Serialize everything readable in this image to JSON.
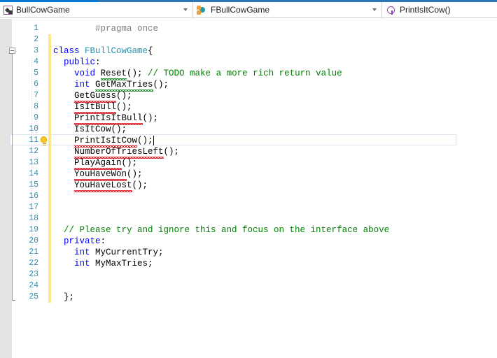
{
  "window": {
    "accent_color": "#0078D4",
    "accent_secondary": "#2E75B6"
  },
  "navbar": {
    "project": {
      "label": "BullCowGame",
      "icon": "project-icon",
      "dropdown_icon": "chevron-down-icon"
    },
    "type": {
      "label": "FBullCowGame",
      "icon": "class-icon",
      "dropdown_icon": "chevron-down-icon"
    },
    "member": {
      "label": "PrintIsItCow()",
      "icon": "method-icon"
    }
  },
  "editor": {
    "change_bar_color": "#FFE88C",
    "line_number_color": "#2B91AF",
    "current_line": 11,
    "quick_action_line": 11,
    "quick_action_icon": "lightbulb-icon",
    "lines": [
      {
        "n": "1",
        "indent": 4,
        "tokens": [
          {
            "t": "#pragma once",
            "c": "pre"
          }
        ]
      },
      {
        "n": "2",
        "indent": 0,
        "tokens": []
      },
      {
        "n": "3",
        "indent": 0,
        "fold": "start",
        "tokens": [
          {
            "t": "class ",
            "c": "kw"
          },
          {
            "t": "FBullCowGame",
            "c": "typ"
          },
          {
            "t": "{",
            "c": "pun"
          }
        ]
      },
      {
        "n": "4",
        "indent": 1,
        "tokens": [
          {
            "t": "public",
            "c": "kw"
          },
          {
            "t": ":",
            "c": "pun"
          }
        ]
      },
      {
        "n": "5",
        "indent": 2,
        "tokens": [
          {
            "t": "void ",
            "c": "kw"
          },
          {
            "t": "Reset",
            "c": "idn",
            "sq": "green"
          },
          {
            "t": "(); ",
            "c": "pun"
          },
          {
            "t": "// TODO make a more rich return value",
            "c": "cmt"
          }
        ]
      },
      {
        "n": "6",
        "indent": 2,
        "tokens": [
          {
            "t": "int ",
            "c": "kw"
          },
          {
            "t": "GetMaxTries",
            "c": "idn",
            "sq": "green"
          },
          {
            "t": "();",
            "c": "pun"
          }
        ]
      },
      {
        "n": "7",
        "indent": 2,
        "tokens": [
          {
            "t": "GetGuess",
            "c": "idn",
            "sq": "red"
          },
          {
            "t": "();",
            "c": "pun"
          }
        ]
      },
      {
        "n": "8",
        "indent": 2,
        "tokens": [
          {
            "t": "IsItBull",
            "c": "idn",
            "sq": "red"
          },
          {
            "t": "();",
            "c": "pun"
          }
        ]
      },
      {
        "n": "9",
        "indent": 2,
        "tokens": [
          {
            "t": "PrintIsItBull",
            "c": "idn",
            "sq": "red"
          },
          {
            "t": "();",
            "c": "pun"
          }
        ]
      },
      {
        "n": "10",
        "indent": 2,
        "tokens": [
          {
            "t": "IsItCow",
            "c": "idn",
            "sq": "red"
          },
          {
            "t": "();",
            "c": "pun"
          }
        ]
      },
      {
        "n": "11",
        "indent": 2,
        "tokens": [
          {
            "t": "PrintIsItCow",
            "c": "idn",
            "sq": "red"
          },
          {
            "t": "();",
            "c": "pun"
          }
        ]
      },
      {
        "n": "12",
        "indent": 2,
        "tokens": [
          {
            "t": "NumberOfTriesLeft",
            "c": "idn",
            "sq": "red"
          },
          {
            "t": "();",
            "c": "pun"
          }
        ]
      },
      {
        "n": "13",
        "indent": 2,
        "tokens": [
          {
            "t": "PlayAgain",
            "c": "idn",
            "sq": "red"
          },
          {
            "t": "();",
            "c": "pun"
          }
        ]
      },
      {
        "n": "14",
        "indent": 2,
        "tokens": [
          {
            "t": "YouHaveWon",
            "c": "idn",
            "sq": "red"
          },
          {
            "t": "();",
            "c": "pun"
          }
        ]
      },
      {
        "n": "15",
        "indent": 2,
        "tokens": [
          {
            "t": "YouHaveLost",
            "c": "idn",
            "sq": "red"
          },
          {
            "t": "();",
            "c": "pun"
          }
        ]
      },
      {
        "n": "16",
        "indent": 0,
        "tokens": []
      },
      {
        "n": "17",
        "indent": 0,
        "tokens": []
      },
      {
        "n": "18",
        "indent": 0,
        "tokens": []
      },
      {
        "n": "19",
        "indent": 1,
        "tokens": [
          {
            "t": "// Please try and ignore this and focus on the interface above",
            "c": "cmt"
          }
        ]
      },
      {
        "n": "20",
        "indent": 1,
        "tokens": [
          {
            "t": "private",
            "c": "kw"
          },
          {
            "t": ":",
            "c": "pun"
          }
        ]
      },
      {
        "n": "21",
        "indent": 2,
        "tokens": [
          {
            "t": "int ",
            "c": "kw"
          },
          {
            "t": "MyCurrentTry",
            "c": "idn"
          },
          {
            "t": ";",
            "c": "pun"
          }
        ]
      },
      {
        "n": "22",
        "indent": 2,
        "tokens": [
          {
            "t": "int ",
            "c": "kw"
          },
          {
            "t": "MyMaxTries",
            "c": "idn"
          },
          {
            "t": ";",
            "c": "pun"
          }
        ]
      },
      {
        "n": "23",
        "indent": 0,
        "tokens": []
      },
      {
        "n": "24",
        "indent": 0,
        "tokens": []
      },
      {
        "n": "25",
        "indent": 1,
        "fold": "end",
        "tokens": [
          {
            "t": "};",
            "c": "pun"
          }
        ]
      }
    ]
  }
}
